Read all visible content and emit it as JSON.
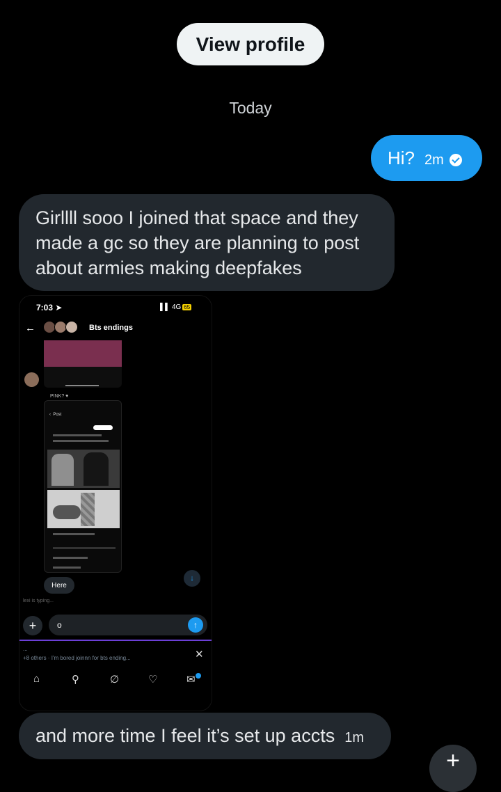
{
  "header": {
    "view_profile_label": "View profile",
    "date_separator": "Today"
  },
  "messages": [
    {
      "direction": "outgoing",
      "text": "Hi?",
      "time": "2m",
      "status_icon": "check-circle-icon"
    },
    {
      "direction": "incoming",
      "lines": [
        "Girllll sooo I joined that space and they",
        "made a gc so they are planning  to post",
        "about armies making deepfakes"
      ]
    },
    {
      "direction": "incoming",
      "type": "image"
    },
    {
      "direction": "incoming",
      "text": "and more time I feel it’s set up accts",
      "time": "1m"
    }
  ],
  "screenshot": {
    "status_time": "7:03",
    "network": "4G",
    "battery": "65",
    "group_title": "Bts endings",
    "here_label": "Here",
    "typing_text": "lexi is typing...",
    "input_value": "o",
    "notification_dots": "...",
    "notification_text": "+8 others · I'm bored joinnn for bts ending...",
    "sender_name": "PINK? ♥",
    "nav_icons": [
      "home-icon",
      "search-icon",
      "grok-icon",
      "bell-icon",
      "mail-icon"
    ]
  },
  "colors": {
    "accent": "#1d9bf0",
    "bubble_in": "#22282e",
    "background": "#000000"
  },
  "fab_icon": "plus-icon"
}
